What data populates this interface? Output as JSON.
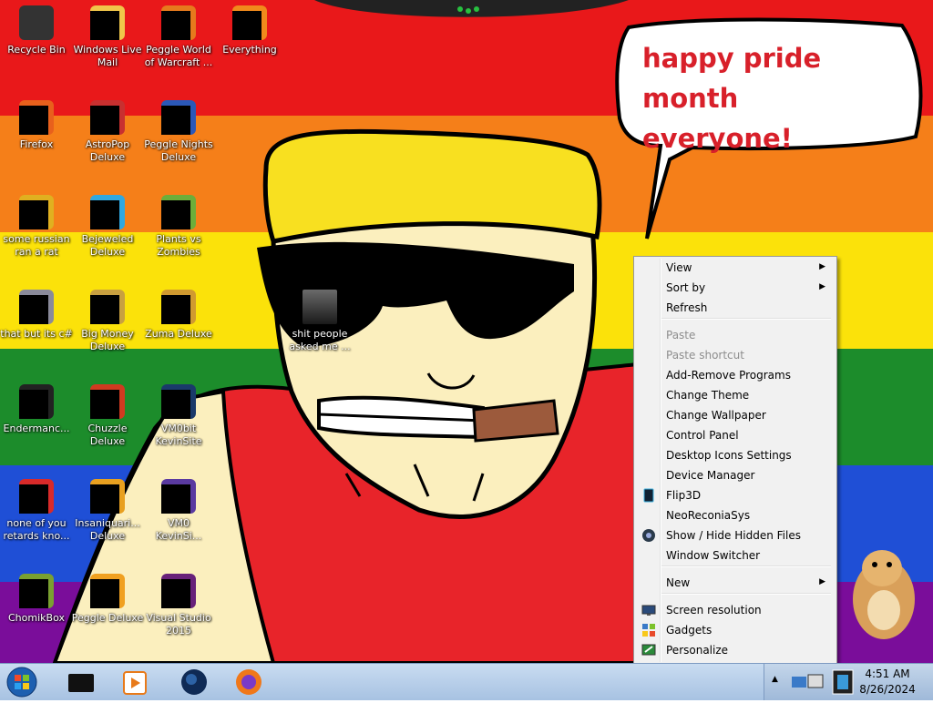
{
  "wallpaper": {
    "stripe_colors": [
      "#e9181a",
      "#f57f19",
      "#fbe20a",
      "#1c8c2b",
      "#1f4fd6",
      "#7a0d9a"
    ],
    "speech_bubble": [
      "happy pride month",
      "everyone!"
    ]
  },
  "desktop_icons": [
    {
      "label": "Recycle Bin",
      "icon": "recycle-bin-icon",
      "color": "#333333"
    },
    {
      "label": "Windows Live\nMail",
      "icon": "mail-icon",
      "color": "#f0c64a"
    },
    {
      "label": "Peggle World\nof Warcraft ...",
      "icon": "peggle-icon",
      "color": "#e67a1d"
    },
    {
      "label": "Everything",
      "icon": "everything-search-icon",
      "color": "#f08a1c"
    },
    {
      "label": "Firefox",
      "icon": "firefox-icon",
      "color": "#e8601c"
    },
    {
      "label": "AstroPop\nDeluxe",
      "icon": "astropop-icon",
      "color": "#c83030"
    },
    {
      "label": "Peggle Nights\nDeluxe",
      "icon": "peggle-nights-icon",
      "color": "#2b58b8"
    },
    {
      "label": "some russian\nran a rat",
      "icon": "image-file-icon",
      "color": "#e0b020"
    },
    {
      "label": "Bejeweled\nDeluxe",
      "icon": "bejeweled-icon",
      "color": "#30a8e0"
    },
    {
      "label": "Plants vs\nZombies",
      "icon": "plants-vs-zombies-icon",
      "color": "#6cae3a"
    },
    {
      "label": "that but its c#",
      "icon": "document-icon",
      "color": "#8a8a9a"
    },
    {
      "label": "Big Money\nDeluxe",
      "icon": "big-money-icon",
      "color": "#c8a040"
    },
    {
      "label": "Zuma Deluxe",
      "icon": "zuma-icon",
      "color": "#d09a30"
    },
    {
      "label": "Endermanc...",
      "icon": "terminal-icon",
      "color": "#222222"
    },
    {
      "label": "Chuzzle\nDeluxe",
      "icon": "chuzzle-icon",
      "color": "#d03a20"
    },
    {
      "label": "VM0bit\nKevinSite",
      "icon": "vm-icon",
      "color": "#1a3a6a"
    },
    {
      "label": "none of you\nretards kno...",
      "icon": "opera-icon",
      "color": "#d82a2a"
    },
    {
      "label": "Insaniquari...\nDeluxe",
      "icon": "insaniquarium-icon",
      "color": "#e8a020"
    },
    {
      "label": "VM0\nKevinSi...",
      "icon": "vm-purple-icon",
      "color": "#5a3aa0"
    },
    {
      "label": "ChomikBox",
      "icon": "chomikbox-icon",
      "color": "#7aa030"
    },
    {
      "label": "Peggle Deluxe",
      "icon": "peggle-deluxe-icon",
      "color": "#f0a020"
    },
    {
      "label": "Visual Studio\n2015",
      "icon": "visual-studio-icon",
      "color": "#68217a"
    }
  ],
  "dropped_folder": {
    "label": "shit people\nasked me ...",
    "icon": "folder-icon"
  },
  "context_menu": {
    "items": [
      {
        "label": "View",
        "submenu": true
      },
      {
        "label": "Sort by",
        "submenu": true
      },
      {
        "label": "Refresh"
      },
      {
        "label": "Paste",
        "disabled": true
      },
      {
        "label": "Paste shortcut",
        "disabled": true
      },
      {
        "label": "Add-Remove Programs"
      },
      {
        "label": "Change Theme"
      },
      {
        "label": "Change Wallpaper"
      },
      {
        "label": "Control Panel"
      },
      {
        "label": "Desktop Icons Settings"
      },
      {
        "label": "Device Manager"
      },
      {
        "label": "Flip3D",
        "icon": "flip3d-icon"
      },
      {
        "label": "NeoReconiaSys"
      },
      {
        "label": "Show / Hide Hidden Files",
        "icon": "hidden-files-icon"
      },
      {
        "label": "Window Switcher"
      },
      {
        "label": "New",
        "submenu": true
      },
      {
        "label": "Screen resolution",
        "icon": "screen-resolution-icon"
      },
      {
        "label": "Gadgets",
        "icon": "gadgets-icon"
      },
      {
        "label": "Personalize",
        "icon": "personalize-icon"
      }
    ]
  },
  "taskbar": {
    "start": "start-orb-icon",
    "pinned": [
      "black-app-icon",
      "media-player-icon",
      "globe-icon",
      "firefox-icon"
    ],
    "tray_expand": "▲",
    "clock_time": "4:51 AM",
    "clock_date": "8/26/2024"
  }
}
